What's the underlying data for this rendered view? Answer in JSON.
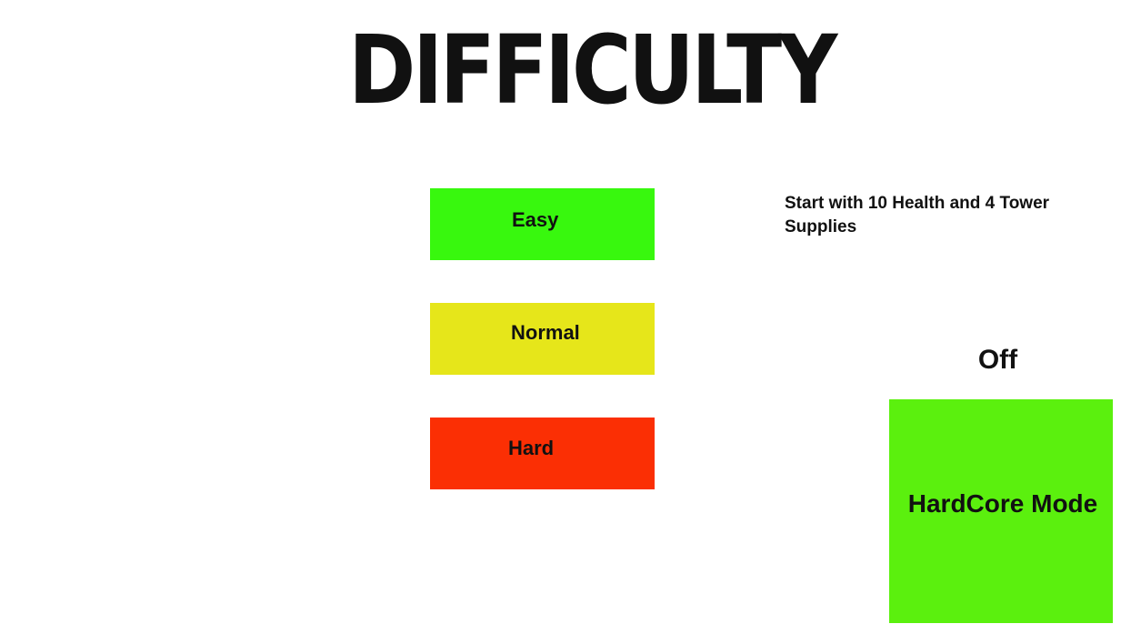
{
  "title": "DIFFICULTY",
  "difficulty_buttons": [
    {
      "label": "Easy",
      "color": "#38f80e"
    },
    {
      "label": "Normal",
      "color": "#e6e61a"
    },
    {
      "label": "Hard",
      "color": "#fb2f04"
    }
  ],
  "description": "Start with 10 Health and 4 Tower Supplies",
  "hardcore": {
    "status": "Off",
    "label": "HardCore Mode",
    "color": "#5bf00e"
  }
}
